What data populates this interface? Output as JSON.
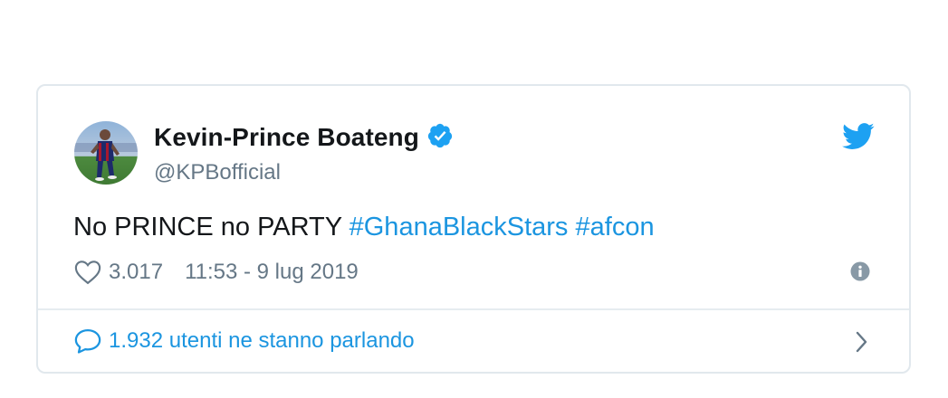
{
  "tweet": {
    "display_name": "Kevin-Prince Boateng",
    "handle": "@KPBofficial",
    "text_plain": "No PRINCE no PARTY ",
    "hashtags": [
      "#GhanaBlackStars",
      "#afcon"
    ],
    "likes": "3.017",
    "timestamp": "11:53 - 9 lug 2019",
    "conversation": "1.932 utenti ne stanno parlando"
  },
  "icons": {
    "verified": "verified-badge-icon",
    "bird": "twitter-bird-icon",
    "heart": "heart-icon",
    "info": "info-icon",
    "reply": "reply-bubble-icon",
    "chevron": "chevron-right-icon"
  },
  "colors": {
    "link": "#1b95e0",
    "verified": "#1da1f2",
    "text": "#14171a",
    "secondary": "#657786",
    "border": "#e1e8ed"
  }
}
